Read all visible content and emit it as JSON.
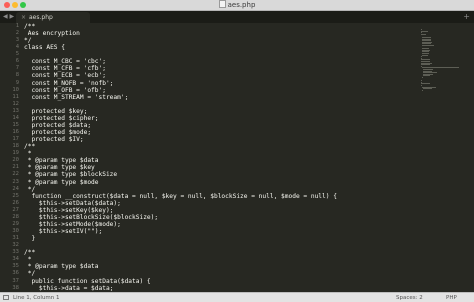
{
  "window": {
    "title": "aes.php"
  },
  "tabs": [
    {
      "label": "aes.php",
      "close": "×"
    }
  ],
  "tab_controls": {
    "arrows": "◀ ▶",
    "add": "+"
  },
  "editor": {
    "first_line_number": 1,
    "lines": [
      {
        "tokens": [
          {
            "t": "/**",
            "c": "comment"
          }
        ]
      },
      {
        "tokens": [
          {
            "t": " Aes encryption",
            "c": "plain"
          }
        ]
      },
      {
        "tokens": [
          {
            "t": "*/",
            "c": "plain"
          }
        ]
      },
      {
        "tokens": [
          {
            "t": "class AES {",
            "c": "plain"
          }
        ]
      },
      {
        "tokens": []
      },
      {
        "tokens": [
          {
            "t": "  const M_CBC = 'cbc';",
            "c": "plain"
          }
        ]
      },
      {
        "tokens": [
          {
            "t": "  const M_CFB = 'cfb';",
            "c": "plain"
          }
        ]
      },
      {
        "tokens": [
          {
            "t": "  const M_ECB = 'ecb';",
            "c": "plain"
          }
        ]
      },
      {
        "tokens": [
          {
            "t": "  const M_NOFB = 'nofb';",
            "c": "plain"
          }
        ]
      },
      {
        "tokens": [
          {
            "t": "  const M_OFB = 'ofb';",
            "c": "plain"
          }
        ]
      },
      {
        "tokens": [
          {
            "t": "  const M_STREAM = 'stream';",
            "c": "plain"
          }
        ]
      },
      {
        "tokens": []
      },
      {
        "tokens": [
          {
            "t": "  protected $key;",
            "c": "plain"
          }
        ]
      },
      {
        "tokens": [
          {
            "t": "  protected $cipher;",
            "c": "plain"
          }
        ]
      },
      {
        "tokens": [
          {
            "t": "  protected $data;",
            "c": "plain"
          }
        ]
      },
      {
        "tokens": [
          {
            "t": "  protected $mode;",
            "c": "plain"
          }
        ]
      },
      {
        "tokens": [
          {
            "t": "  protected $IV;",
            "c": "plain"
          }
        ]
      },
      {
        "tokens": [
          {
            "t": "/**",
            "c": "plain"
          }
        ]
      },
      {
        "tokens": [
          {
            "t": " *",
            "c": "plain"
          }
        ]
      },
      {
        "tokens": [
          {
            "t": " * @param type $data",
            "c": "plain"
          }
        ]
      },
      {
        "tokens": [
          {
            "t": " * @param type $key",
            "c": "plain"
          }
        ]
      },
      {
        "tokens": [
          {
            "t": " * @param type $blockSize",
            "c": "plain"
          }
        ]
      },
      {
        "tokens": [
          {
            "t": " * @param type $mode",
            "c": "plain"
          }
        ]
      },
      {
        "tokens": [
          {
            "t": " */",
            "c": "plain"
          }
        ]
      },
      {
        "tokens": [
          {
            "t": "  function __construct($data = null, $key = null, $blockSize = null, $mode = null) {",
            "c": "plain"
          }
        ]
      },
      {
        "tokens": [
          {
            "t": "    $this->setData($data);",
            "c": "plain"
          }
        ]
      },
      {
        "tokens": [
          {
            "t": "    $this->setKey($key);",
            "c": "plain"
          }
        ]
      },
      {
        "tokens": [
          {
            "t": "    $this->setBlockSize($blockSize);",
            "c": "plain"
          }
        ]
      },
      {
        "tokens": [
          {
            "t": "    $this->setMode($mode);",
            "c": "plain"
          }
        ]
      },
      {
        "tokens": [
          {
            "t": "    $this->setIV(\"\");",
            "c": "plain"
          }
        ]
      },
      {
        "tokens": [
          {
            "t": "  }",
            "c": "plain"
          }
        ]
      },
      {
        "tokens": []
      },
      {
        "tokens": [
          {
            "t": "/**",
            "c": "plain"
          }
        ]
      },
      {
        "tokens": [
          {
            "t": " *",
            "c": "plain"
          }
        ]
      },
      {
        "tokens": [
          {
            "t": " * @param type $data",
            "c": "plain"
          }
        ]
      },
      {
        "tokens": [
          {
            "t": " */",
            "c": "plain"
          }
        ]
      },
      {
        "tokens": [
          {
            "t": "  public function setData($data) {",
            "c": "plain"
          }
        ]
      },
      {
        "tokens": [
          {
            "t": "    $this->data = $data;",
            "c": "plain"
          }
        ]
      },
      {
        "tokens": [
          {
            "t": "  }",
            "c": "plain"
          }
        ]
      }
    ]
  },
  "statusbar": {
    "position": "Line 1, Column 1",
    "spaces": "Spaces: 2",
    "syntax": "PHP"
  }
}
